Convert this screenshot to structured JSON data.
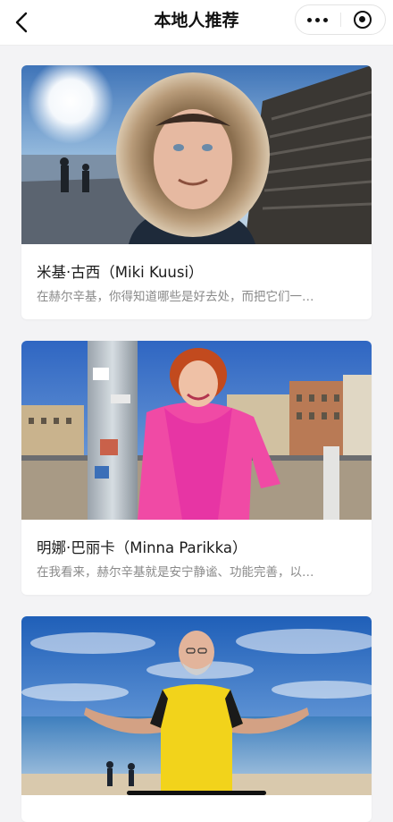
{
  "header": {
    "title": "本地人推荐",
    "back_icon": "chevron-left-icon",
    "more_icon": "more-dots-icon",
    "close_icon": "target-circle-icon"
  },
  "cards": [
    {
      "name": "米基·古西（Miki Kuusi）",
      "desc": "在赫尔辛基，你得知道哪些是好去处，而把它们一…"
    },
    {
      "name": "明娜·巴丽卡（Minna Parikka）",
      "desc": "在我看来，赫尔辛基就是安宁静谧、功能完善，以…"
    },
    {
      "name": "",
      "desc": ""
    }
  ],
  "colors": {
    "background": "#f3f3f5",
    "card": "#ffffff",
    "title_text": "#111111",
    "desc_text": "#8a8a8a"
  }
}
